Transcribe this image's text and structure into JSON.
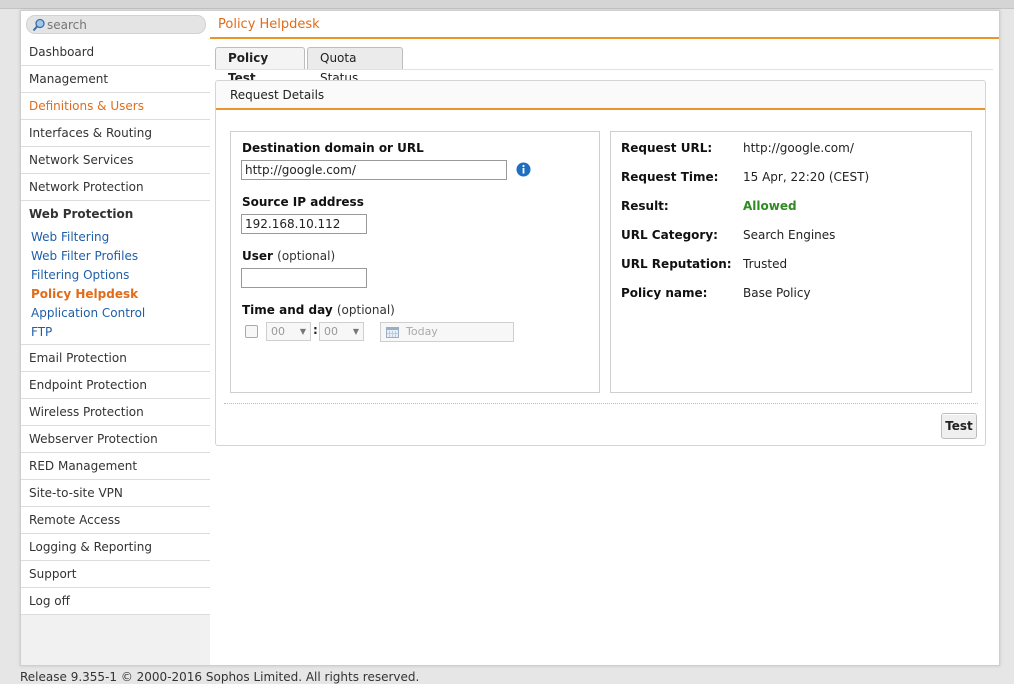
{
  "search": {
    "placeholder": "search"
  },
  "page_title": "Policy Helpdesk",
  "sidebar": {
    "items": [
      {
        "label": "Dashboard"
      },
      {
        "label": "Management"
      },
      {
        "label": "Definitions & Users",
        "active": true
      },
      {
        "label": "Interfaces & Routing"
      },
      {
        "label": "Network Services"
      },
      {
        "label": "Network Protection"
      },
      {
        "label": "Web Protection",
        "expanded": true
      },
      {
        "label": "Email Protection"
      },
      {
        "label": "Endpoint Protection"
      },
      {
        "label": "Wireless Protection"
      },
      {
        "label": "Webserver Protection"
      },
      {
        "label": "RED Management"
      },
      {
        "label": "Site-to-site VPN"
      },
      {
        "label": "Remote Access"
      },
      {
        "label": "Logging & Reporting"
      },
      {
        "label": "Support"
      },
      {
        "label": "Log off"
      }
    ],
    "web_protection_sub": [
      {
        "label": "Web Filtering"
      },
      {
        "label": "Web Filter Profiles"
      },
      {
        "label": "Filtering Options"
      },
      {
        "label": "Policy Helpdesk",
        "active": true
      },
      {
        "label": "Application Control"
      },
      {
        "label": "FTP"
      }
    ]
  },
  "tabs": [
    {
      "label": "Policy Test",
      "active": true
    },
    {
      "label": "Quota Status"
    }
  ],
  "panel": {
    "title": "Request Details",
    "form": {
      "dest_label": "Destination domain or URL",
      "dest_value": "http://google.com/",
      "source_label": "Source IP address",
      "source_value": "192.168.10.112",
      "user_label": "User",
      "user_optional": "(optional)",
      "user_value": "",
      "time_label": "Time and day",
      "time_optional": "(optional)",
      "hour": "00",
      "minute": "00",
      "colon": ":",
      "date_placeholder": "Today"
    },
    "result": {
      "rows": [
        {
          "label": "Request URL:",
          "value": "http://google.com/"
        },
        {
          "label": "Request Time:",
          "value": "15 Apr, 22:20 (CEST)"
        },
        {
          "label": "Result:",
          "value": "Allowed"
        },
        {
          "label": "URL Category:",
          "value": "Search Engines"
        },
        {
          "label": "URL Reputation:",
          "value": "Trusted"
        },
        {
          "label": "Policy name:",
          "value": "Base Policy"
        }
      ]
    },
    "test_button": "Test"
  },
  "footer": "Release 9.355-1  © 2000-2016 Sophos Limited. All rights reserved.",
  "colors": {
    "accent": "#e06c1a",
    "link": "#1f5fa8",
    "allowed": "#2e8b21"
  }
}
